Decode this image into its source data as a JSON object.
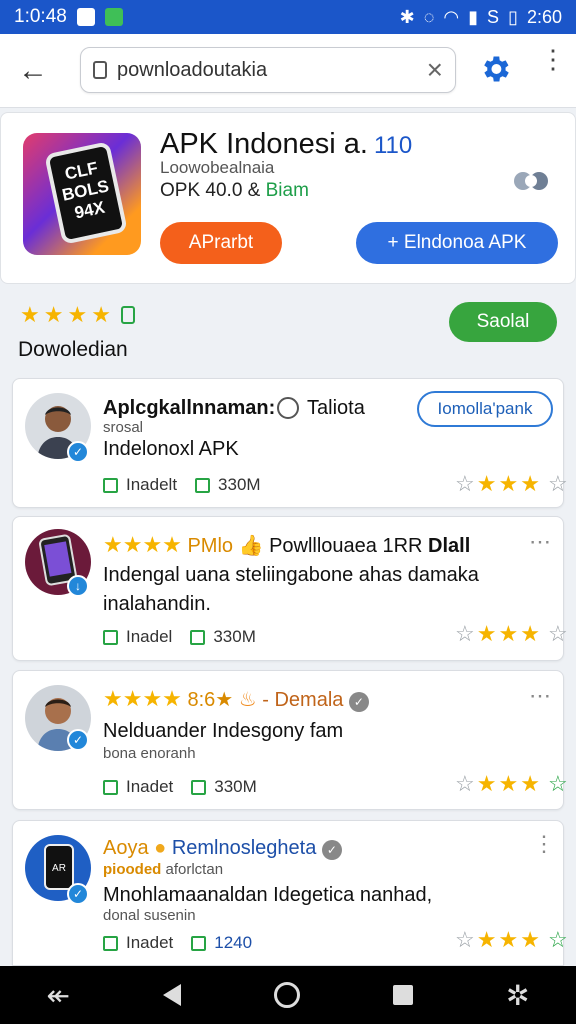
{
  "status_bar": {
    "time_left": "1:0:48",
    "time_right": "2:60",
    "signal_text": "S"
  },
  "browser": {
    "url": "pownloadoutakia"
  },
  "app": {
    "name": "APK Indonesi a.",
    "name_badge": "110",
    "developer": "Loowobealnaia",
    "version": "OPK 40.0 &",
    "version_tag": "Biam",
    "icon_text": "CLF\nBOLS\n94X",
    "primary_button": "APrarbt",
    "secondary_button": "+ Elndonoa APK"
  },
  "rating": {
    "stars": 4,
    "label": "Dowoledian",
    "action_button": "Saolal"
  },
  "posts": [
    {
      "title": "Aplcgkallnnaman:",
      "title_extra": "Taliota",
      "subtitle": "srosal",
      "body": "Indelonoxl APK",
      "meta_left": "Inadelt",
      "meta_right": "330M",
      "action": "Iomolla'pank",
      "rating": 3
    },
    {
      "stars_text": "★★★★",
      "title": "PMlo",
      "title_extra": "Powlllouaea 1RR",
      "title_tail": "Dlall",
      "body": "Indengal uana steliingabone ahas damaka inalahandin.",
      "meta_left": "Inadel",
      "meta_right": "330M",
      "rating": 3
    },
    {
      "stars_text": "★★★★",
      "title": "8:6★",
      "title_extra": "- Demala",
      "body": "Nelduander Indesgony fam",
      "subtitle": "bona enoranh",
      "meta_left": "Inadet",
      "meta_right": "330M",
      "rating": 3
    },
    {
      "title": "Aoya",
      "title_extra": "Remlnoslegheta",
      "subtitle_colored": "piooded",
      "subtitle": "aforlctan",
      "body": "Mnohlamaanaldan Idegetica nanhad,",
      "subtitle2": "donal susenin",
      "meta_left": "Inadet",
      "meta_right": "1240",
      "rating": 3
    }
  ],
  "colors": {
    "status_bar": "#1b56c9",
    "accent_blue": "#2f6fe0",
    "orange": "#f4601b",
    "green": "#37a53e",
    "star": "#f6b400"
  }
}
